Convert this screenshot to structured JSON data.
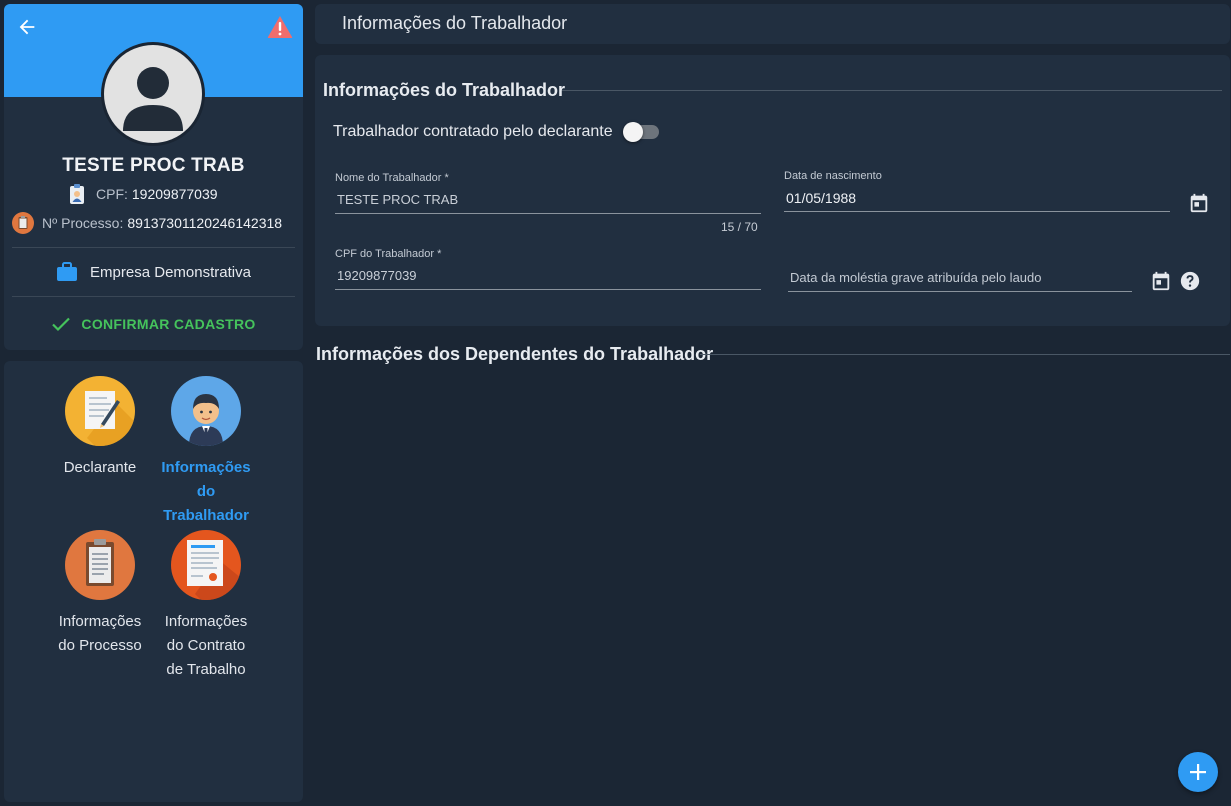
{
  "profile": {
    "name": "TESTE PROC TRAB",
    "cpf_label": "CPF:",
    "cpf_value": "19209877039",
    "process_label": "Nº Processo:",
    "process_value": "89137301120246142318",
    "company": "Empresa Demonstrativa",
    "confirm_label": "CONFIRMAR CADASTRO"
  },
  "nav": {
    "items": [
      {
        "label": "Declarante",
        "active": false,
        "icon": "document-pen-icon"
      },
      {
        "label": "Informações do Trabalhador",
        "active": true,
        "icon": "worker-avatar-icon"
      },
      {
        "label": "Informações do Processo",
        "active": false,
        "icon": "clipboard-icon"
      },
      {
        "label": "Informações do Contrato de Trabalho",
        "active": false,
        "icon": "contract-icon"
      }
    ]
  },
  "header": {
    "title": "Informações do Trabalhador"
  },
  "form": {
    "section_title": "Informações do Trabalhador",
    "toggle_label": "Trabalhador contratado pelo declarante",
    "toggle_on": false,
    "nome_label": "Nome do Trabalhador *",
    "nome_value": "TESTE PROC TRAB",
    "nome_counter": "15 / 70",
    "nascimento_label": "Data de nascimento",
    "nascimento_value": "01/05/1988",
    "cpf_label": "CPF do Trabalhador *",
    "cpf_value": "19209877039",
    "molestia_placeholder": "Data da moléstia grave atribuída pelo laudo"
  },
  "dependentes": {
    "section_title": "Informações dos Dependentes do Trabalhador"
  },
  "colors": {
    "accent": "#2f9bf3",
    "confirm": "#45c35c",
    "background": "#1b2634",
    "card": "#212f40",
    "warning": "#f06d6d"
  }
}
